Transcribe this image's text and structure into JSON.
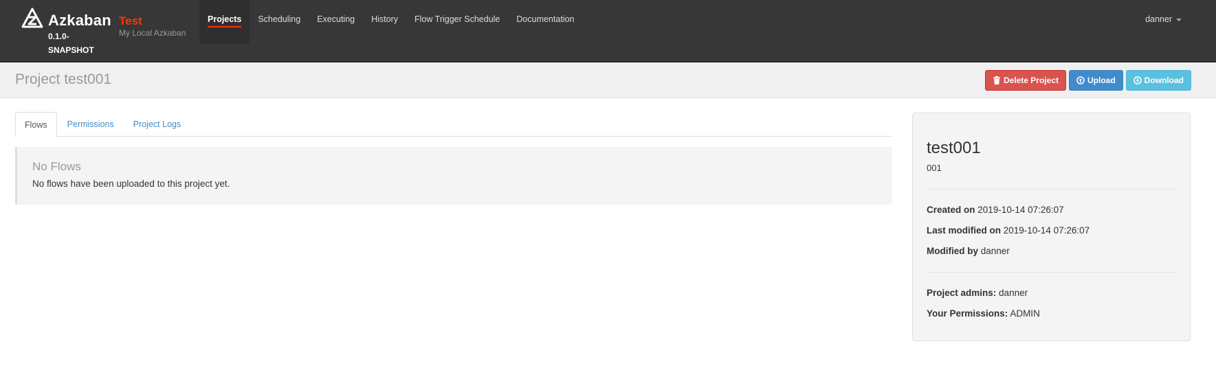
{
  "navbar": {
    "brand_name": "Azkaban",
    "brand_version": "0.1.0-SNAPSHOT",
    "env_name": "Test",
    "env_desc": "My Local Azkaban",
    "items": [
      {
        "label": "Projects",
        "active": true
      },
      {
        "label": "Scheduling",
        "active": false
      },
      {
        "label": "Executing",
        "active": false
      },
      {
        "label": "History",
        "active": false
      },
      {
        "label": "Flow Trigger Schedule",
        "active": false
      },
      {
        "label": "Documentation",
        "active": false
      }
    ],
    "user": "danner"
  },
  "page_header": {
    "title": "Project test001",
    "buttons": {
      "delete": "Delete Project",
      "upload": "Upload",
      "download": "Download"
    }
  },
  "tabs": [
    {
      "label": "Flows",
      "active": true
    },
    {
      "label": "Permissions",
      "active": false
    },
    {
      "label": "Project Logs",
      "active": false
    }
  ],
  "flows": {
    "empty_title": "No Flows",
    "empty_text": "No flows have been uploaded to this project yet."
  },
  "project_info": {
    "name": "test001",
    "description": "001",
    "created_label": "Created on",
    "created_value": "2019-10-14 07:26:07",
    "modified_label": "Last modified on",
    "modified_value": "2019-10-14 07:26:07",
    "modified_by_label": "Modified by",
    "modified_by_value": "danner",
    "admins_label": "Project admins:",
    "admins_value": "danner",
    "permissions_label": "Your Permissions:",
    "permissions_value": "ADMIN"
  },
  "colors": {
    "navbar_bg": "#373737",
    "accent": "#ff3601",
    "link": "#428bca",
    "danger": "#d9534f",
    "primary": "#428bca",
    "info": "#5bc0de"
  }
}
